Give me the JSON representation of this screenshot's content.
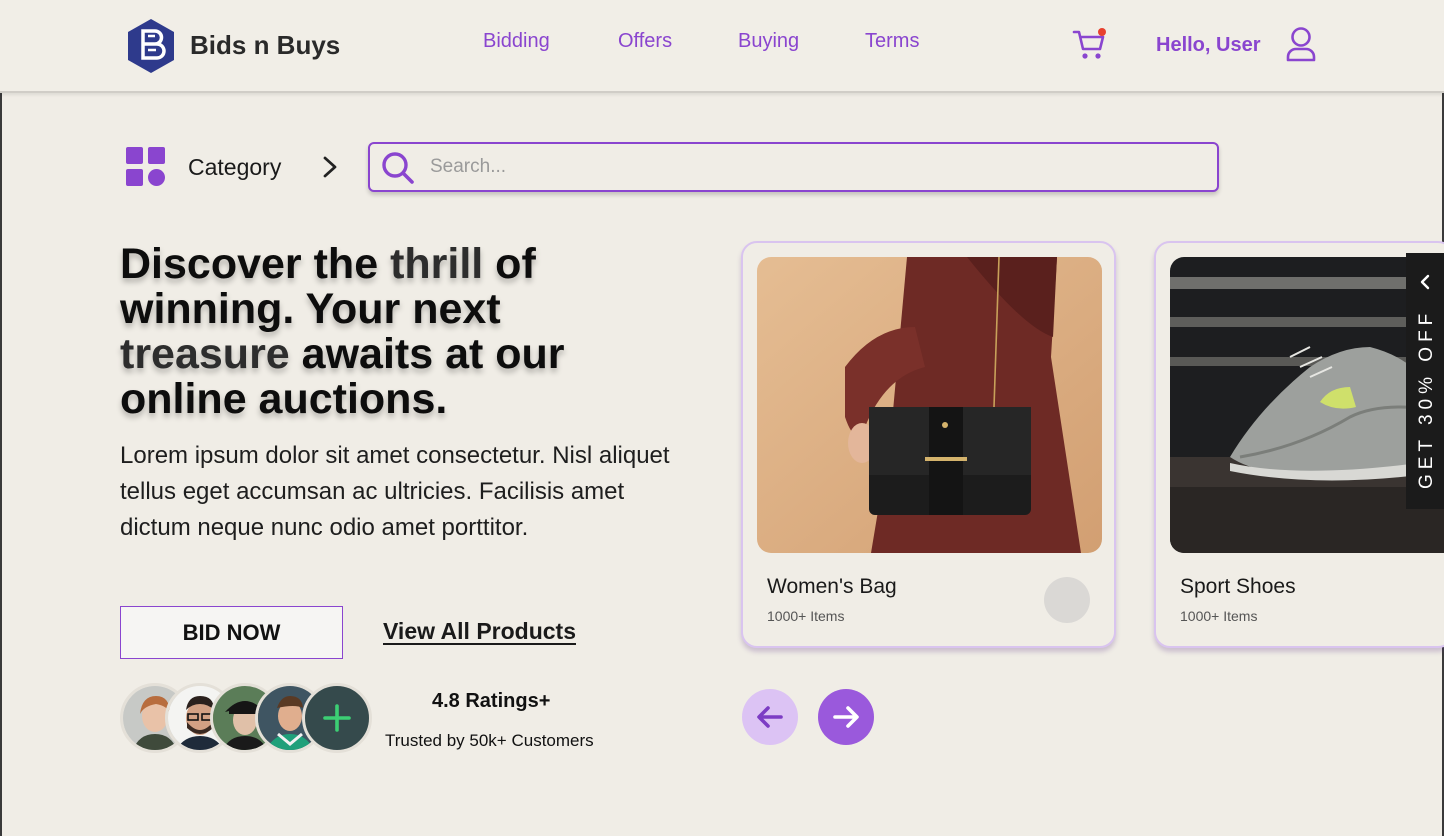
{
  "brand": {
    "name": "Bids n Buys",
    "logo_icon": "hexagon-b-logo-icon"
  },
  "nav": {
    "items": [
      {
        "label": "Bidding"
      },
      {
        "label": "Offers"
      },
      {
        "label": "Buying"
      },
      {
        "label": "Terms"
      }
    ]
  },
  "header": {
    "greeting": "Hello, User",
    "cart_icon": "shopping-cart-icon",
    "user_icon": "user-icon",
    "cart_has_notification": true
  },
  "category": {
    "label": "Category",
    "icon": "grid-category-icon",
    "chevron_icon": "chevron-right-icon"
  },
  "search": {
    "placeholder": "Search...",
    "value": "",
    "icon": "search-icon"
  },
  "hero": {
    "title_parts": [
      "Discover the ",
      "thrill",
      " of winning. Your next ",
      "treasure",
      " awaits at our online auctions."
    ],
    "body": "Lorem ipsum dolor sit amet consectetur. Nisl aliquet tellus eget accumsan ac ultricies. Facilisis amet dictum neque nunc odio amet porttitor.",
    "bid_button": "BID NOW",
    "view_all_link": "View All Products"
  },
  "social_proof": {
    "rating": "4.8 Ratings+",
    "trusted": "Trusted by 50k+ Customers",
    "plus_icon": "plus-icon"
  },
  "products": [
    {
      "name": "Women's Bag",
      "count": "1000+ Items"
    },
    {
      "name": "Sport Shoes",
      "count": "1000+ Items"
    }
  ],
  "carousel": {
    "prev_icon": "arrow-left-icon",
    "next_icon": "arrow-right-icon"
  },
  "promo_tab": {
    "label": "GET 30% OFF",
    "icon": "chevron-up-icon"
  },
  "colors": {
    "accent": "#8a45cf",
    "background": "#f0ede6",
    "promo_bg": "#1b1b1b",
    "notification": "#e8412f"
  }
}
